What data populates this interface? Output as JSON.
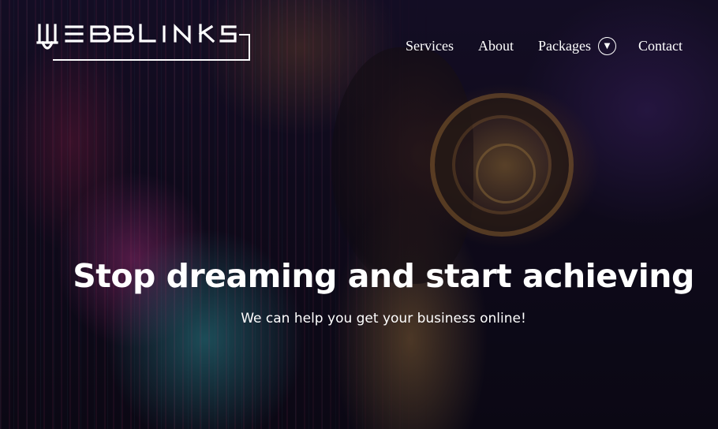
{
  "brand": {
    "logo_text": "WEBBLINKS",
    "logo_color": "#ffffff"
  },
  "nav": {
    "services_label": "Services",
    "about_label": "About",
    "packages_label": "Packages",
    "packages_dropdown_icon": "triangle-down-icon",
    "contact_label": "Contact"
  },
  "hero": {
    "headline": "Stop dreaming and start achieving",
    "subline": "We can help you get your business online!",
    "background_image": "illustrated person wearing headphones in neon city"
  },
  "colors": {
    "text": "#ffffff",
    "background": "#120d22"
  }
}
